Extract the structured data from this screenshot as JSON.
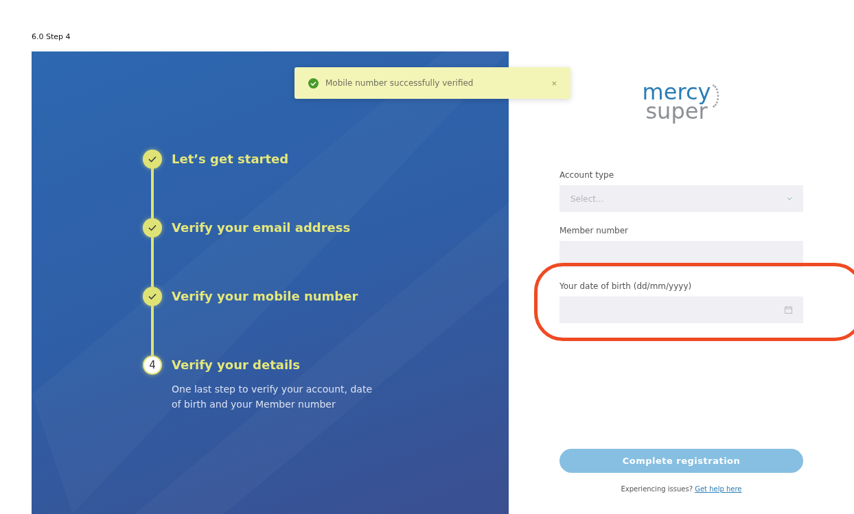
{
  "page_label": "6.0 Step 4",
  "toast": {
    "message": "Mobile number successfully verified",
    "close": "×"
  },
  "steps": [
    {
      "title": "Let’s get started",
      "completed": true
    },
    {
      "title": "Verify your email address",
      "completed": true
    },
    {
      "title": "Verify your mobile number",
      "completed": true
    },
    {
      "title": "Verify your details",
      "completed": false,
      "number": "4",
      "description": "One last step to verify your account, date of birth and your Member number"
    }
  ],
  "logo": {
    "line1": "mercy",
    "line2": "super"
  },
  "form": {
    "fields": [
      {
        "label": "Account type",
        "kind": "select",
        "placeholder": "Select..."
      },
      {
        "label": "Member number",
        "kind": "text"
      },
      {
        "label": "Your date of birth (dd/mm/yyyy)",
        "kind": "date"
      }
    ],
    "submit": {
      "label": "Complete registration",
      "disabled": true
    },
    "help_text": "Experiencing issues?",
    "help_link": "Get help here"
  }
}
